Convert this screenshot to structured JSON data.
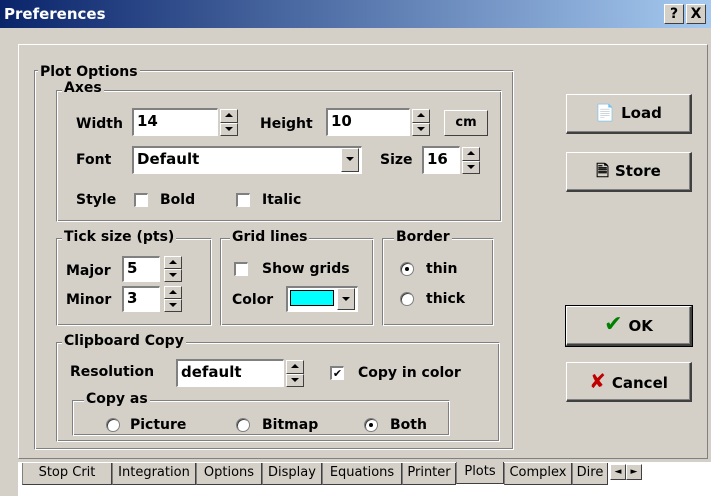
{
  "window": {
    "title": "Preferences",
    "help_label": "?",
    "close_label": "X"
  },
  "plot_options": {
    "title": "Plot Options",
    "axes": {
      "title": "Axes",
      "width_label": "Width",
      "width_value": "14",
      "height_label": "Height",
      "height_value": "10",
      "unit_button": "cm",
      "font_label": "Font",
      "font_value": "Default",
      "size_label": "Size",
      "size_value": "16",
      "style_label": "Style",
      "bold_label": "Bold",
      "italic_label": "Italic",
      "bold_checked": false,
      "italic_checked": false
    },
    "tick_size": {
      "title": "Tick size (pts)",
      "major_label": "Major",
      "major_value": "5",
      "minor_label": "Minor",
      "minor_value": "3"
    },
    "grid_lines": {
      "title": "Grid lines",
      "show_grids_label": "Show grids",
      "show_grids_checked": false,
      "color_label": "Color",
      "color_value": "#00ffff"
    },
    "border": {
      "title": "Border",
      "thin_label": "thin",
      "thick_label": "thick",
      "selected": "thin"
    },
    "clipboard": {
      "title": "Clipboard Copy",
      "resolution_label": "Resolution",
      "resolution_value": "default",
      "copy_in_color_label": "Copy in color",
      "copy_in_color_checked": true,
      "copy_as": {
        "title": "Copy as",
        "picture_label": "Picture",
        "bitmap_label": "Bitmap",
        "both_label": "Both",
        "selected": "Both"
      }
    }
  },
  "buttons": {
    "load": {
      "label": "Load",
      "icon": "load-icon"
    },
    "store": {
      "label": "Store",
      "icon": "store-icon"
    },
    "ok": {
      "label": "OK",
      "icon": "checkmark-icon",
      "icon_color": "#008000"
    },
    "cancel": {
      "label": "Cancel",
      "icon": "x-icon",
      "icon_color": "#c00000"
    }
  },
  "tabs": [
    "Stop Crit",
    "Integration",
    "Options",
    "Display",
    "Equations",
    "Printer",
    "Plots",
    "Complex",
    "Dire"
  ],
  "active_tab": "Plots"
}
